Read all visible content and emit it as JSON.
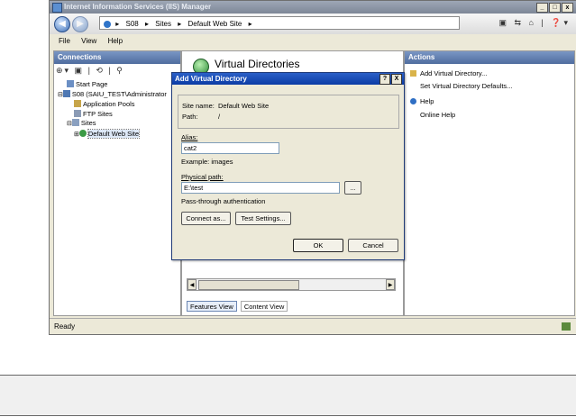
{
  "window": {
    "title": "Internet Information Services (IIS) Manager",
    "min": "_",
    "max": "□",
    "close": "x"
  },
  "address": {
    "root": "S08",
    "sites": "Sites",
    "site": "Default Web Site",
    "sep": "▸"
  },
  "menu": {
    "file": "File",
    "view": "View",
    "help": "Help"
  },
  "connections": {
    "header": "Connections",
    "tree": [
      {
        "label": "Start Page",
        "depth": 1
      },
      {
        "label": "S08 (SAIU_TEST\\Administrator",
        "depth": 0
      },
      {
        "label": "Application Pools",
        "depth": 2
      },
      {
        "label": "FTP Sites",
        "depth": 2
      },
      {
        "label": "Sites",
        "depth": 1
      },
      {
        "label": "Default Web Site",
        "depth": 2
      }
    ]
  },
  "center": {
    "title": "Virtual Directories",
    "tab_features": "Features View",
    "tab_content": "Content View"
  },
  "actions": {
    "header": "Actions",
    "items": [
      "Add Virtual Directory...",
      "Set Virtual Directory Defaults...",
      "Help",
      "Online Help"
    ]
  },
  "status": {
    "text": "Ready"
  },
  "dialog": {
    "title": "Add Virtual Directory",
    "help_btn": "?",
    "close_btn": "X",
    "site_name_label": "Site name:",
    "site_name_value": "Default Web Site",
    "path_label": "Path:",
    "path_value": "/",
    "alias_label": "Alias:",
    "alias_value": "cat2",
    "example": "Example: images",
    "physical_label": "Physical path:",
    "physical_value": "E:\\test",
    "browse": "...",
    "passthrough": "Pass-through authentication",
    "connect_as": "Connect as...",
    "test_settings": "Test Settings...",
    "ok": "OK",
    "cancel": "Cancel"
  }
}
